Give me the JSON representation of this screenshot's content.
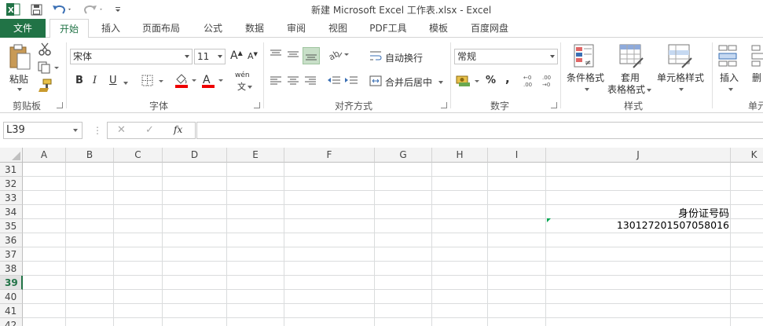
{
  "window": {
    "title": "新建 Microsoft Excel 工作表.xlsx - Excel"
  },
  "quick_access": {
    "app_icon": "excel-logo-icon",
    "save_icon": "save-icon",
    "undo_icon": "undo-icon",
    "redo_icon": "redo-icon",
    "customize_icon": "customize-qat-icon"
  },
  "tabs": {
    "file": "文件",
    "home": "开始",
    "insert": "插入",
    "layout": "页面布局",
    "formulas": "公式",
    "data": "数据",
    "review": "审阅",
    "view": "视图",
    "pdf": "PDF工具",
    "templates": "模板",
    "baidu": "百度网盘"
  },
  "ribbon": {
    "clipboard": {
      "paste": "粘贴",
      "group": "剪贴板"
    },
    "font": {
      "name": "宋体",
      "size": "11",
      "grow": "A",
      "shrink": "A",
      "bold": "B",
      "italic": "I",
      "underline": "U",
      "phonetic": "wén",
      "group": "字体"
    },
    "alignment": {
      "wrap": "自动换行",
      "merge": "合并后居中",
      "group": "对齐方式"
    },
    "number": {
      "format": "常规",
      "percent": "%",
      "comma": ",",
      "group": "数字"
    },
    "styles": {
      "conditional": "条件格式",
      "table_1": "套用",
      "table_2": "表格格式",
      "cell_styles": "单元格样式",
      "group": "样式"
    },
    "cells": {
      "insert": "插入",
      "delete": "删",
      "group": "单元"
    }
  },
  "formula_bar": {
    "name_box": "L39",
    "fx": "fx",
    "cancel": "✕",
    "enter": "✓",
    "value": ""
  },
  "columns": [
    "A",
    "B",
    "C",
    "D",
    "E",
    "F",
    "G",
    "H",
    "I",
    "J",
    "K"
  ],
  "rows": [
    "31",
    "32",
    "33",
    "34",
    "35",
    "36",
    "37",
    "38",
    "39",
    "40",
    "41",
    "42"
  ],
  "active_row": "39",
  "cells": {
    "J34": "身份证号码",
    "J35": "130127201507058016"
  },
  "colors": {
    "accent": "#217346",
    "error_indicator": "#00a651"
  }
}
